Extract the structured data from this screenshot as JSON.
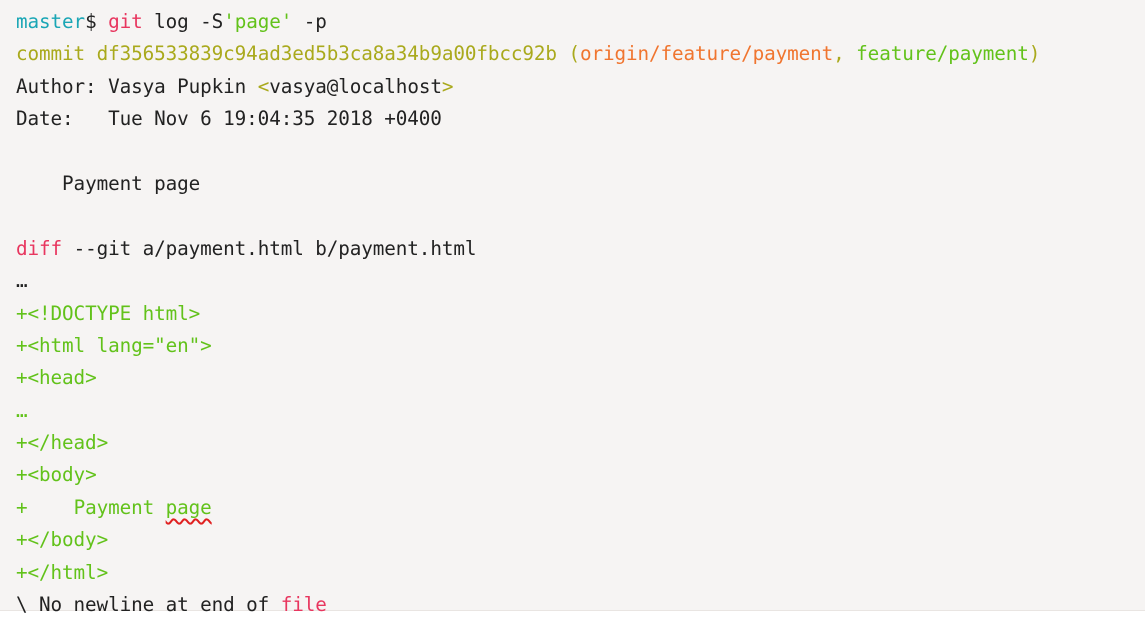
{
  "terminal": {
    "prompt": {
      "cwd": "master",
      "symbol": "$",
      "command": "git",
      "args_before": "log -S",
      "quoted_arg": "'page'",
      "args_after": "-p"
    },
    "commit": {
      "label": "commit",
      "hash": "df356533839c94ad3ed5b3ca8a34b9a00fbcc92b",
      "paren_open": "(",
      "remote_ref": "origin/feature/payment",
      "separator": ",",
      "local_ref": "feature/payment",
      "paren_close": ")"
    },
    "author": {
      "label": "Author:",
      "name": "Vasya Pupkin",
      "email_open": "<",
      "email": "vasya@localhost",
      "email_close": ">"
    },
    "date": {
      "label": "Date:",
      "value": "Tue Nov 6 19:04:35 2018 +0400"
    },
    "message": "Payment page",
    "diff_header": {
      "keyword": "diff",
      "rest": "--git a/payment.html b/payment.html"
    },
    "ellipsis_1": "…",
    "diff_lines": [
      {
        "prefix": "+<",
        "tag": "!DOCTYPE html",
        "suffix": ">"
      },
      {
        "prefix": "+<",
        "tag": "html lang=",
        "attr": "\"en\"",
        "suffix": ">"
      },
      {
        "prefix": "+<",
        "tag": "head",
        "suffix": ">"
      }
    ],
    "ellipsis_2": "…",
    "diff_lines_2": [
      {
        "prefix": "+</",
        "tag": "head",
        "suffix": ">"
      },
      {
        "prefix": "+<",
        "tag": "body",
        "suffix": ">"
      }
    ],
    "body_line": {
      "plus": "+",
      "text": "Payment",
      "highlight": "page"
    },
    "diff_lines_3": [
      {
        "prefix": "+</",
        "tag": "body",
        "suffix": ">"
      },
      {
        "prefix": "+</",
        "tag": "html",
        "suffix": ">"
      }
    ],
    "eof": {
      "text": "\\ No newline at end of",
      "word": "file"
    },
    "colors": {
      "background": "#f6f4f3",
      "prompt_cyan": "#1aa6b5",
      "keyword_red": "#e8365f",
      "hash_olive": "#a9a91c",
      "ref_orange": "#f0752f",
      "ref_green": "#62c21a",
      "added_green": "#62c21a",
      "text": "#222222"
    }
  }
}
